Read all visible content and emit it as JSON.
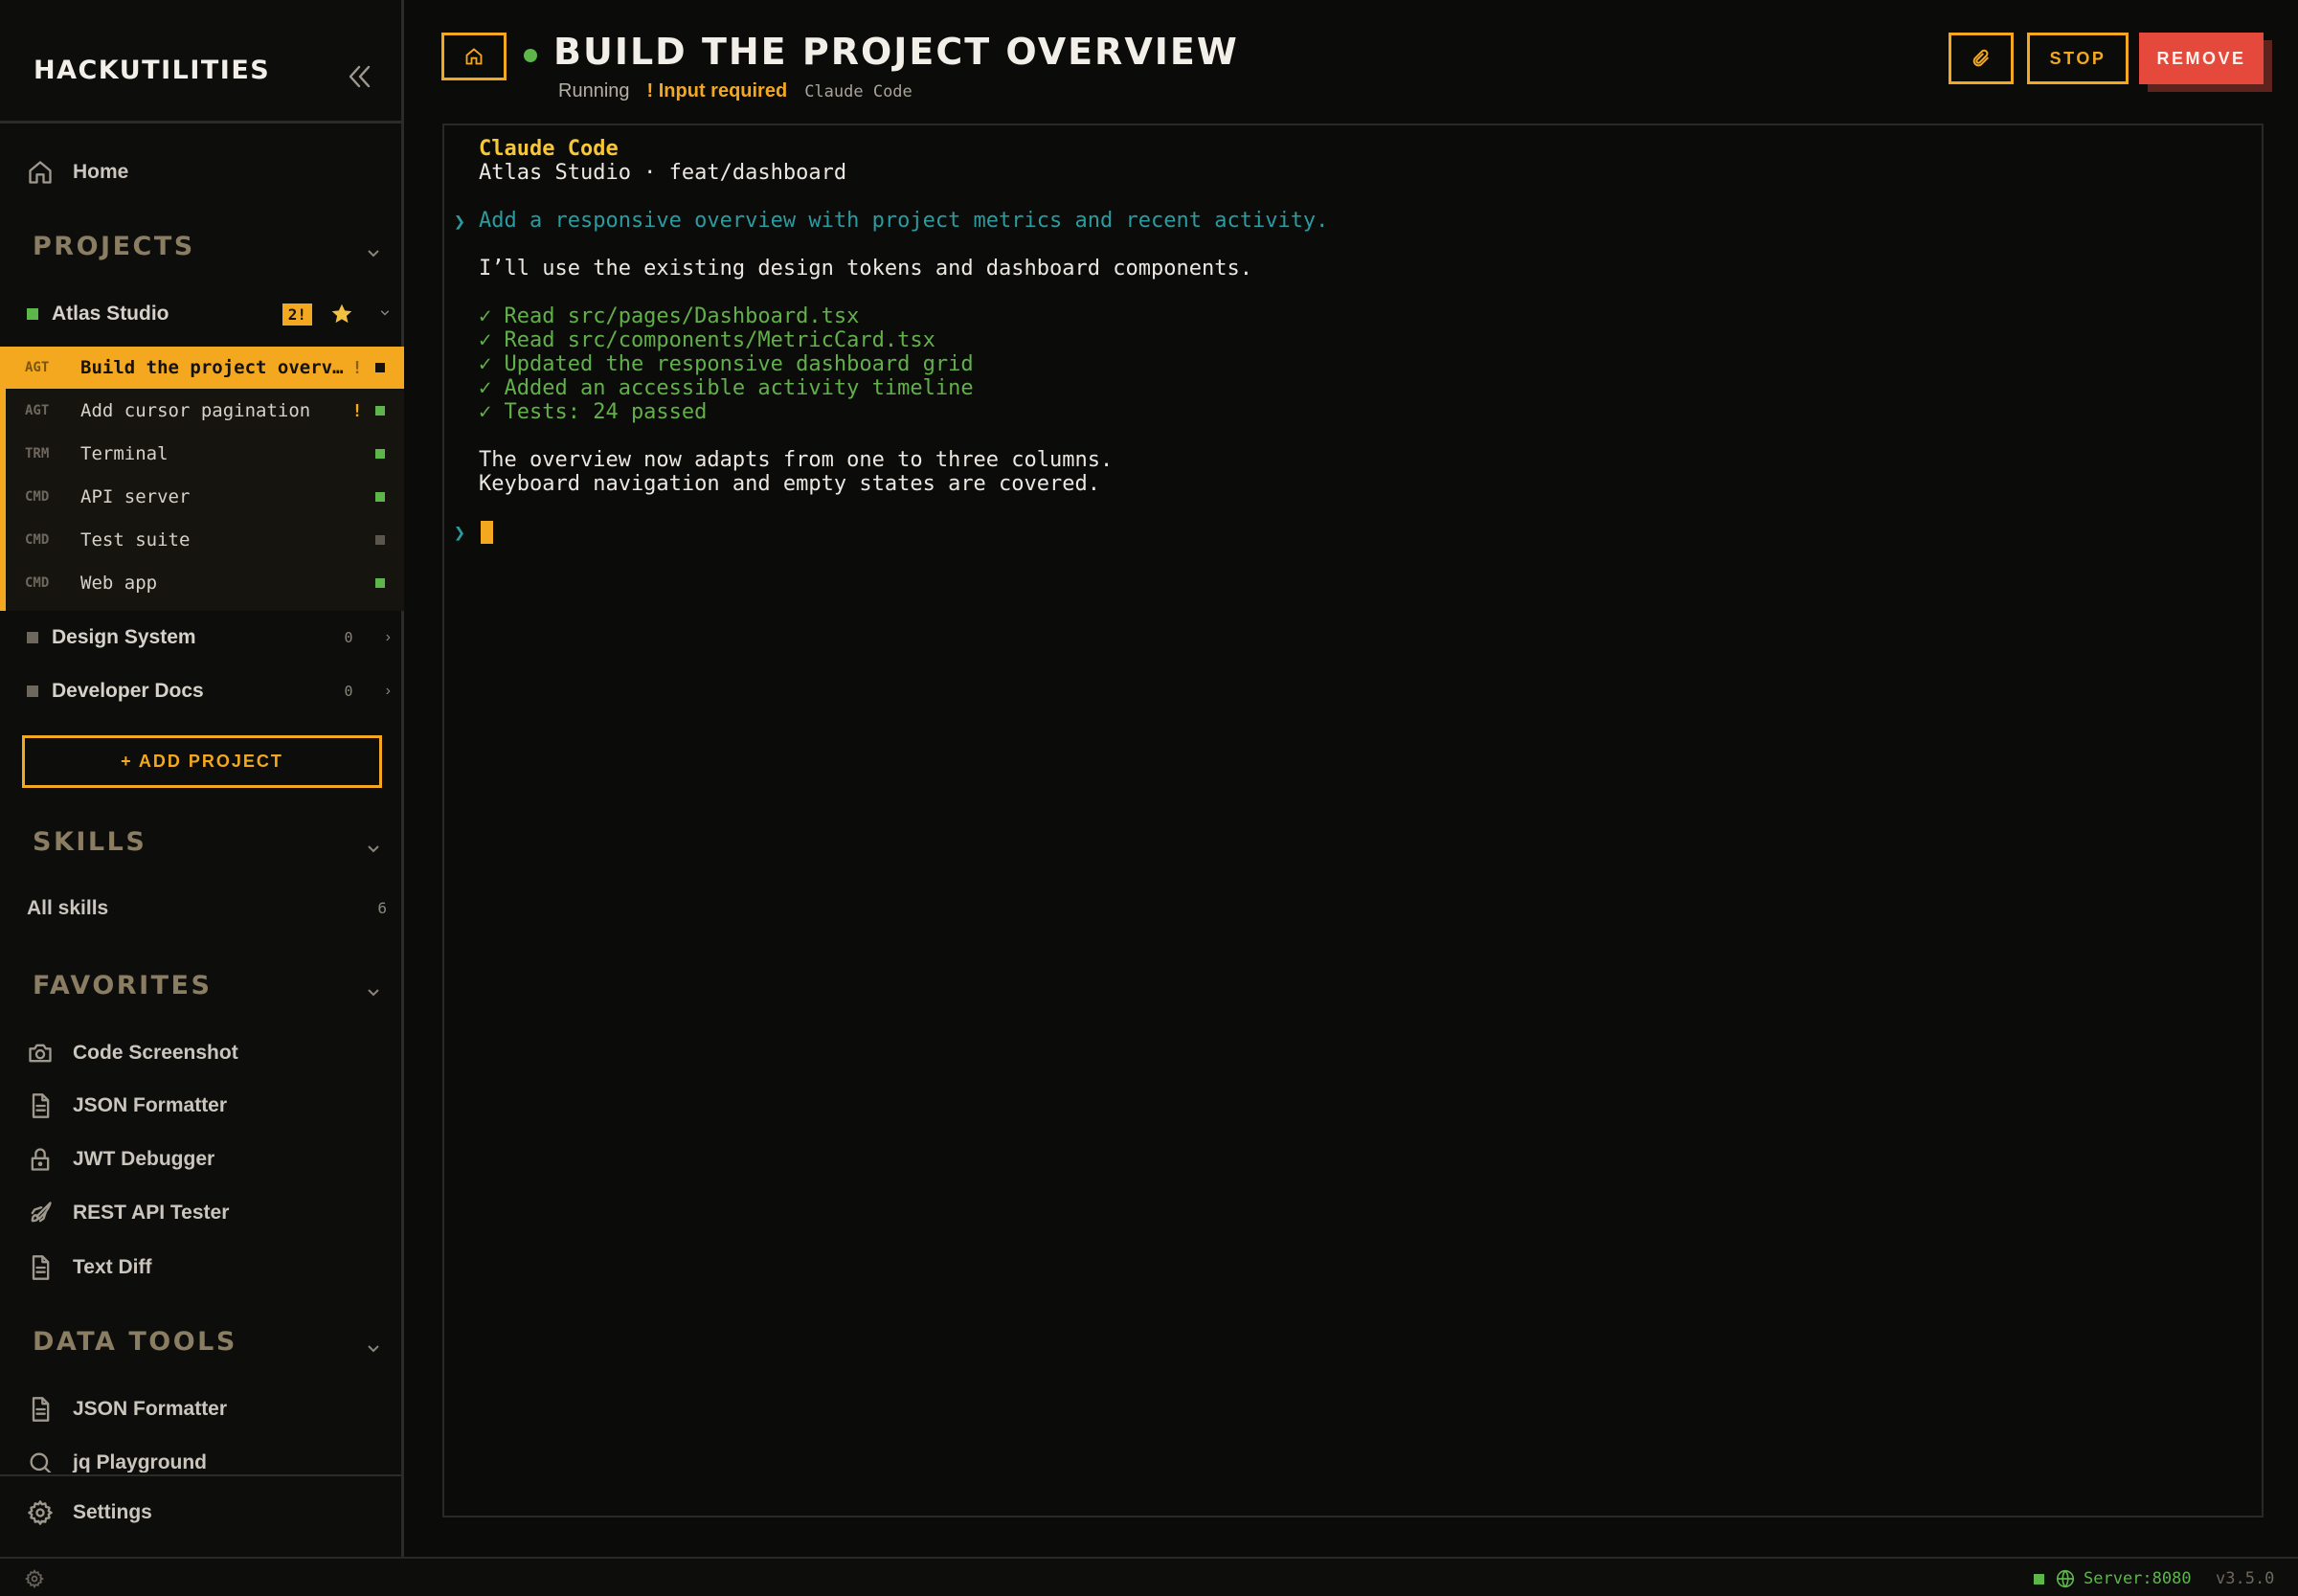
{
  "app": {
    "brand": "HACKUTILITIES"
  },
  "sidebar": {
    "home_label": "Home",
    "projects_title": "PROJECTS",
    "projects": [
      {
        "name": "Atlas Studio",
        "badge": "2!",
        "color": "#5cb649",
        "expanded": true
      },
      {
        "name": "Design System",
        "count": "0",
        "color": "#6d675d"
      },
      {
        "name": "Developer Docs",
        "count": "0",
        "color": "#6d675d"
      }
    ],
    "sessions": [
      {
        "kind": "AGT",
        "name": "Build the project overview",
        "alert": "!",
        "status_color": "#151311",
        "active": true
      },
      {
        "kind": "AGT",
        "name": "Add cursor pagination",
        "alert": "!",
        "status_color": "#5cb649"
      },
      {
        "kind": "TRM",
        "name": "Terminal",
        "alert": "",
        "status_color": "#5cb649"
      },
      {
        "kind": "CMD",
        "name": "API server",
        "alert": "",
        "status_color": "#5cb649"
      },
      {
        "kind": "CMD",
        "name": "Test suite",
        "alert": "",
        "status_color": "#5a564e"
      },
      {
        "kind": "CMD",
        "name": "Web app",
        "alert": "",
        "status_color": "#5cb649"
      }
    ],
    "add_project_label": "+ ADD PROJECT",
    "skills_title": "SKILLS",
    "all_skills_label": "All skills",
    "all_skills_count": "6",
    "favorites_title": "FAVORITES",
    "favorites": [
      {
        "label": "Code Screenshot",
        "icon": "camera-icon"
      },
      {
        "label": "JSON Formatter",
        "icon": "file-icon"
      },
      {
        "label": "JWT Debugger",
        "icon": "lock-icon"
      },
      {
        "label": "REST API Tester",
        "icon": "rocket-icon"
      },
      {
        "label": "Text Diff",
        "icon": "file-icon"
      }
    ],
    "data_tools_title": "DATA TOOLS",
    "data_tools": [
      {
        "label": "JSON Formatter",
        "icon": "file-icon"
      },
      {
        "label": "jq Playground",
        "icon": "search-icon"
      }
    ],
    "settings_label": "Settings"
  },
  "header": {
    "title": "BUILD THE PROJECT OVERVIEW",
    "status": "Running",
    "input_required": "! Input required",
    "agent": "Claude Code",
    "stop_label": "STOP",
    "remove_label": "REMOVE"
  },
  "terminal": {
    "heading": "Claude Code",
    "context": "Atlas Studio · feat/dashboard",
    "prompt_glyph": "❯",
    "user_prompt": "Add a responsive overview with project metrics and recent activity.",
    "reply": "I’ll use the existing design tokens and dashboard components.",
    "checks": [
      "✓ Read src/pages/Dashboard.tsx",
      "✓ Read src/components/MetricCard.tsx",
      "✓ Updated the responsive dashboard grid",
      "✓ Added an accessible activity timeline",
      "✓ Tests: 24 passed"
    ],
    "summary": [
      "The overview now adapts from one to three columns.",
      "Keyboard navigation and empty states are covered."
    ]
  },
  "statusbar": {
    "server": "Server:8080",
    "version": "v3.5.0"
  },
  "colors": {
    "accent": "#f3a81f",
    "danger": "#e5493c",
    "ok": "#5cb649",
    "prompt": "#2a9ca0"
  }
}
